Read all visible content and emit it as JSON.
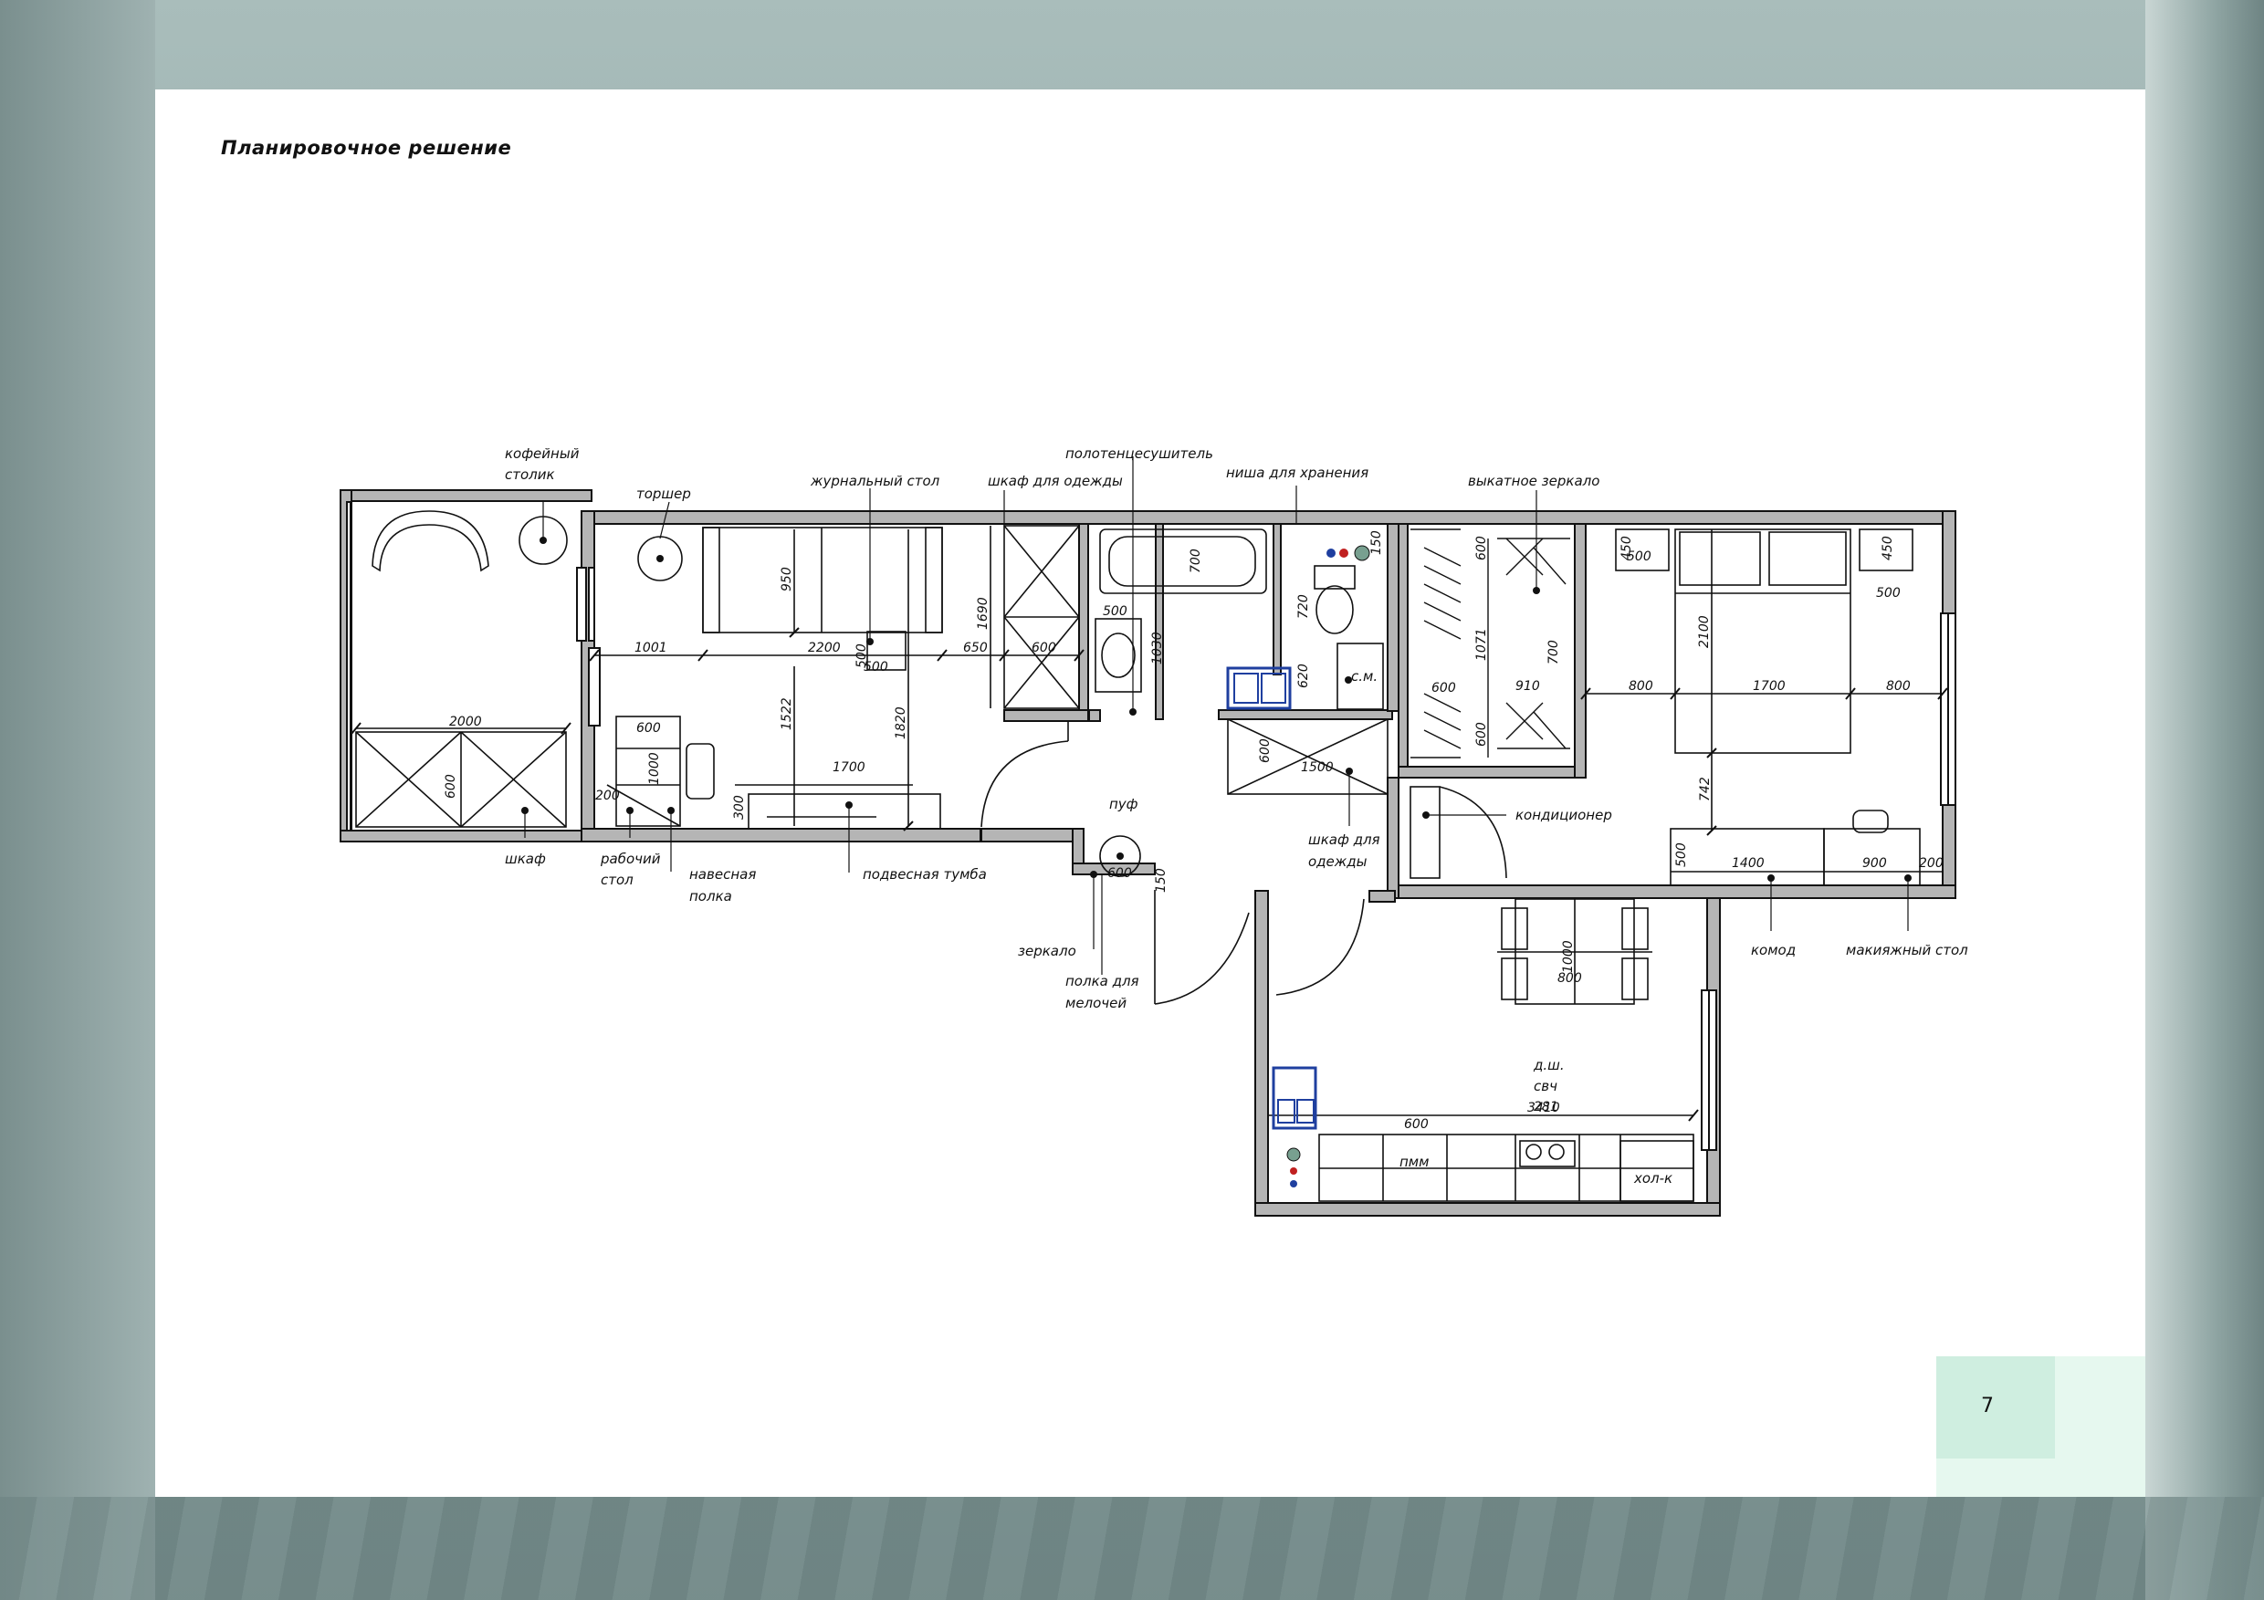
{
  "page": {
    "title": "Планировочное решение",
    "number": "7"
  },
  "labels": {
    "coffee_table": "кофейный",
    "coffee_table_2": "столик",
    "floor_lamp": "торшер",
    "magazine_table": "журнальный стол",
    "wardrobe_top": "шкаф для одежды",
    "towel_dryer": "полотенцесушитель",
    "storage_niche": "ниша для хранения",
    "pull_out_mirror": "выкатное зеркало",
    "wardrobe_left": "шкаф",
    "work_desk": "рабочий",
    "work_desk_2": "стол",
    "hanging_shelf": "навесная",
    "hanging_shelf_2": "полка",
    "hanging_cabinet": "подвесная тумба",
    "pouf": "пуф",
    "mirror": "зеркало",
    "change_shelf": "полка для",
    "change_shelf_2": "мелочей",
    "wardrobe_hall": "шкаф для",
    "wardrobe_hall_2": "одежды",
    "air_conditioner": "кондиционер",
    "dresser": "комод",
    "vanity_table": "макияжный стол",
    "washer": "с.м.",
    "dishwasher": "д.ш.",
    "microwave": "свч",
    "dw_short": "пмм",
    "fridge": "хол-к"
  },
  "dimensions": {
    "d2000": "2000",
    "d600a": "600",
    "d1001": "1001",
    "d2200": "2200",
    "d650": "650",
    "d600b": "600",
    "d950": "950",
    "d500a": "500",
    "d500b": "500",
    "d1522": "1522",
    "d1820": "1820",
    "d1690": "1690",
    "d1700a": "1700",
    "d600c": "600",
    "d1000a": "1000",
    "d200a": "200",
    "d300": "300",
    "d700a": "700",
    "d500c": "500",
    "d1030": "1030",
    "d720": "720",
    "d620": "620",
    "d150a": "150",
    "d600d": "600",
    "d1500": "1500",
    "d600e": "600",
    "d1071": "1071",
    "d700b": "700",
    "d910": "910",
    "d600f": "600",
    "d600g": "600",
    "d600h": "600",
    "d800a": "800",
    "d1700b": "1700",
    "d800b": "800",
    "d2100": "2100",
    "d450a": "450",
    "d500d": "500",
    "d450b": "450",
    "d500e": "500",
    "d742": "742",
    "d500f": "500",
    "d1400": "1400",
    "d900": "900",
    "d200b": "200",
    "d600i": "600",
    "d150b": "150",
    "d1000b": "1000",
    "d800c": "800",
    "d3410": "3410",
    "d281": "281",
    "d600j": "600"
  },
  "colors": {
    "wall": "#b5b5b5",
    "ink": "#111111",
    "accent_blue": "#1f3f9f",
    "sheet": "#ffffff",
    "page_num_bg": "#cfeee0"
  }
}
